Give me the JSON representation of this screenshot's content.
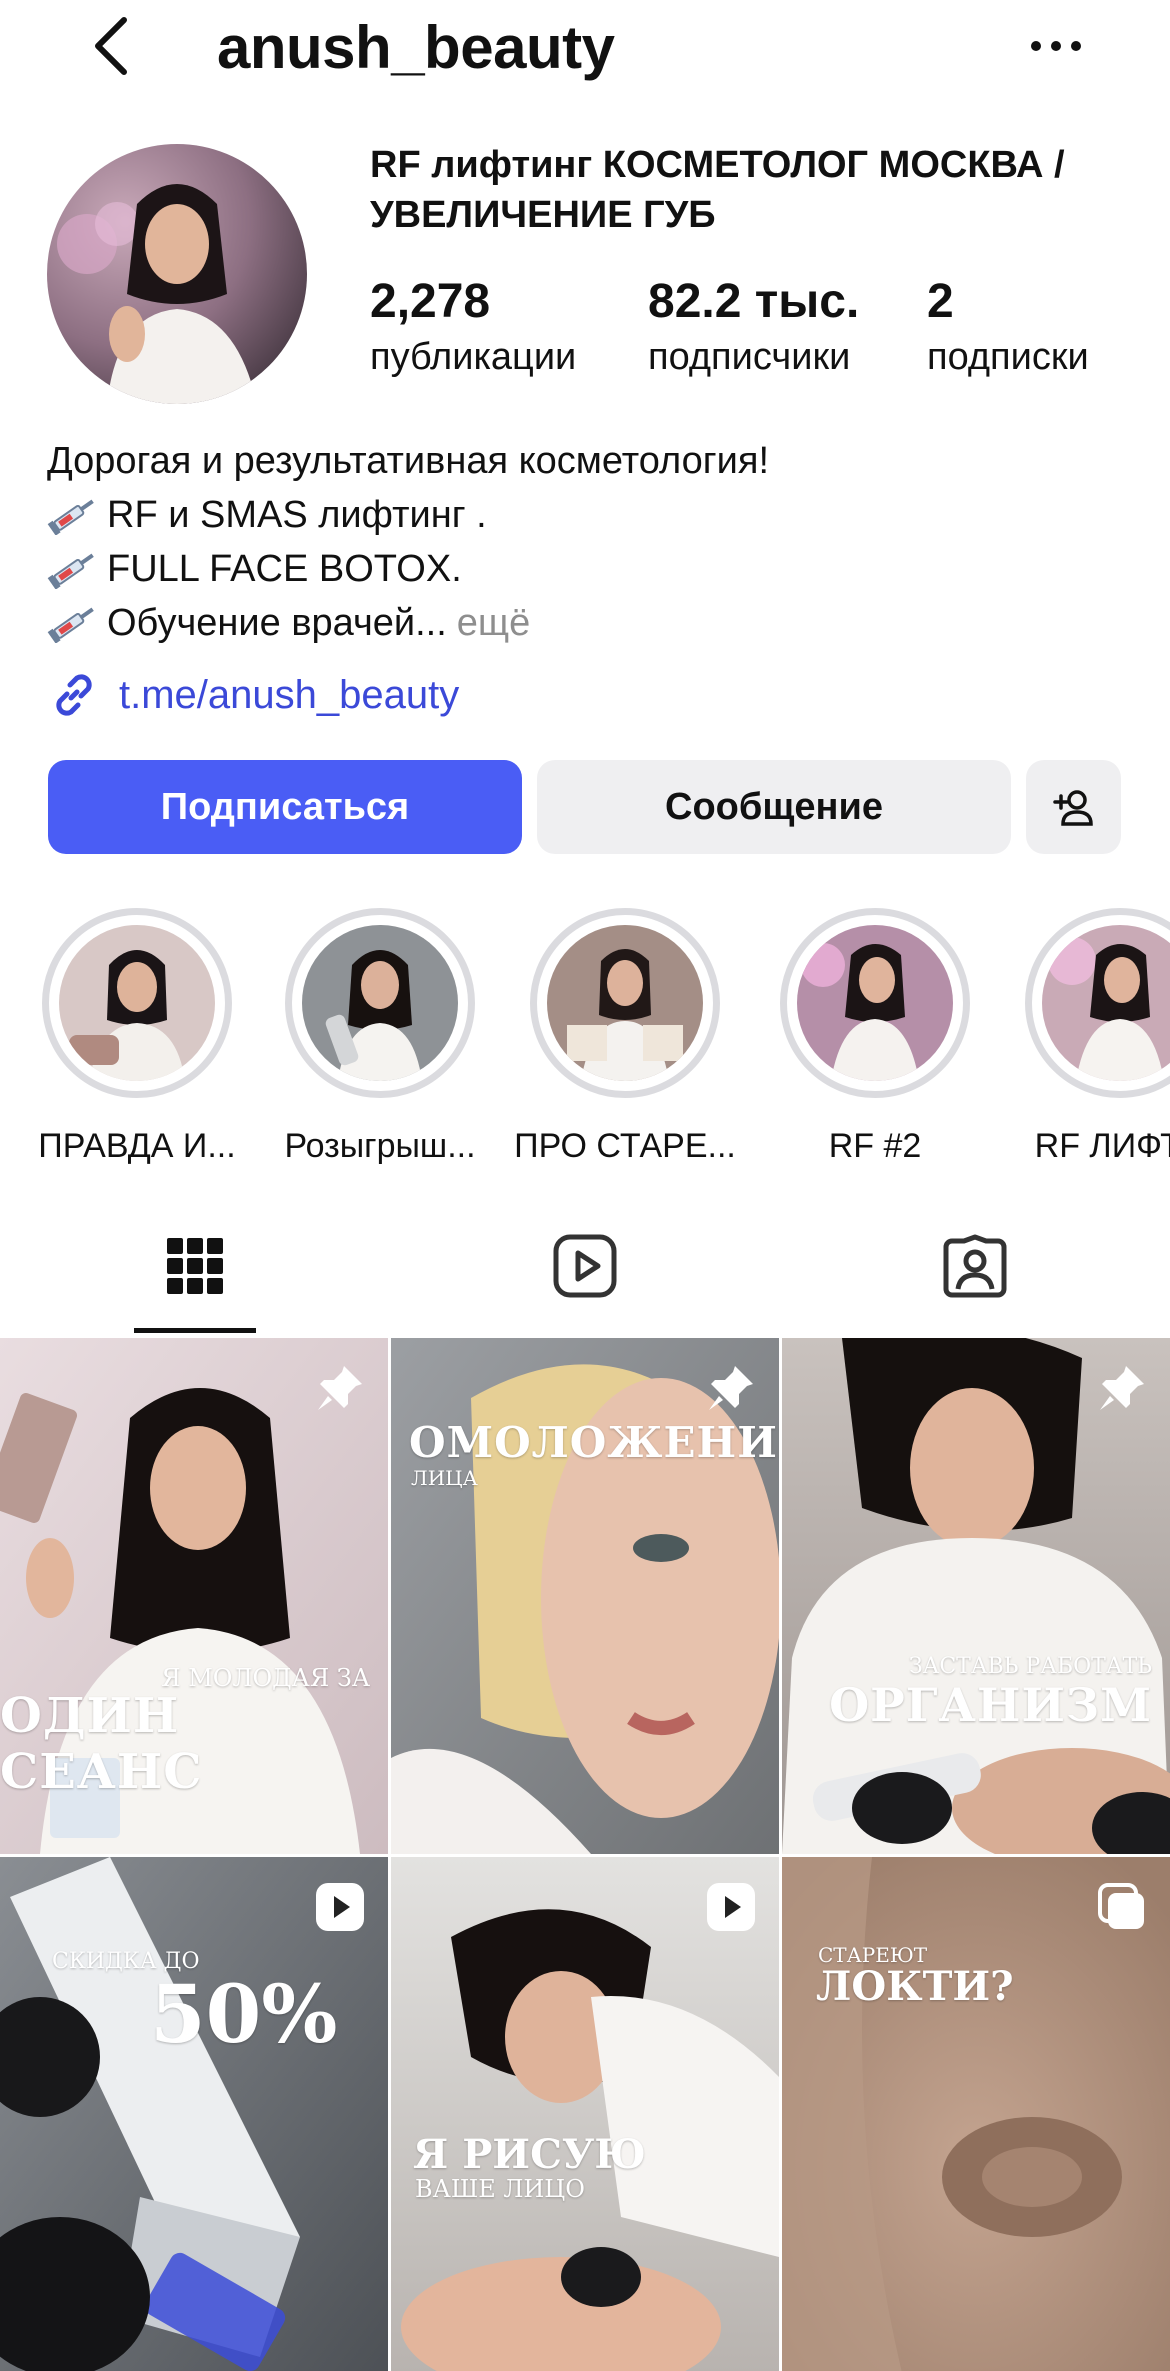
{
  "header": {
    "username": "anush_beauty",
    "back_icon": "chevron-left-icon",
    "more_icon": "more-horizontal-icon"
  },
  "profile": {
    "full_name": "RF лифтинг КОСМЕТОЛОГ МОСКВА / УВЕЛИЧЕНИЕ ГУБ",
    "stats": [
      {
        "value": "2,278",
        "label": "публикации"
      },
      {
        "value": "82.2 тыс.",
        "label": "подписчики"
      },
      {
        "value": "2",
        "label": "подписки"
      }
    ],
    "bio": {
      "line1": "Дорогая и результативная косметология!",
      "line2": "RF и SMAS лифтинг .",
      "line3": "FULL FACE BOTOX.",
      "line4": "Обучение врачей...",
      "more": "ещё"
    },
    "link": "t.me/anush_beauty"
  },
  "actions": {
    "follow": "Подписаться",
    "message": "Сообщение"
  },
  "highlights": [
    {
      "label": "ПРАВДА И..."
    },
    {
      "label": "Розыгрыш..."
    },
    {
      "label": "ПРО СТАРЕ..."
    },
    {
      "label": "RF #2"
    },
    {
      "label": "RF ЛИФТИ"
    }
  ],
  "tabs": [
    "grid-icon",
    "reels-icon",
    "tagged-icon"
  ],
  "posts": [
    {
      "line1": "Я МОЛОДАЯ ЗА",
      "line2": "ОДИН СЕАНС",
      "badge": "pin-icon"
    },
    {
      "line1": "ОМОЛОЖЕНИЕ",
      "line2": "ЛИЦА",
      "badge": "pin-icon"
    },
    {
      "line1": "ЗАСТАВЬ РАБОТАТЬ",
      "line2": "ОРГАНИЗМ",
      "badge": "pin-icon"
    },
    {
      "line1": "СКИДКА ДО",
      "line2": "50%",
      "badge": "reel-icon"
    },
    {
      "line1": "Я РИСУЮ",
      "line2": "ВАШЕ ЛИЦО",
      "badge": "reel-icon"
    },
    {
      "line1": "СТАРЕЮТ",
      "line2": "ЛОКТИ?",
      "badge": "carousel-icon"
    }
  ],
  "colors": {
    "accent": "#4a5df5",
    "link": "#3b49d8",
    "secondary_button": "#efeff1"
  }
}
